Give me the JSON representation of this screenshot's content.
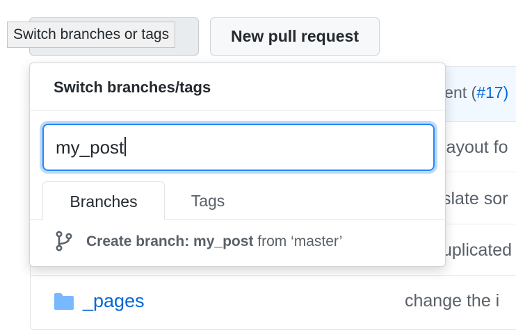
{
  "tooltip": "Switch branches or tags",
  "new_pr_label": "New pull request",
  "background": {
    "commit_message_fragment": "ment (",
    "commit_link": "#17",
    "commit_close": ")",
    "row_fragments": [
      "layout fo",
      "slate sor",
      "uplicated"
    ],
    "folder_name": "_pages",
    "folder_commit": "change the i"
  },
  "dropdown": {
    "title": "Switch branches/tags",
    "filter_value": "my_post",
    "tabs": [
      "Branches",
      "Tags"
    ],
    "create_prefix": "Create branch: ",
    "create_branch_name": "my_post",
    "create_suffix": " from ‘master’"
  },
  "icons": {
    "folder": "folder-icon",
    "branch": "git-branch-icon"
  },
  "colors": {
    "link": "#0366d6",
    "focus": "#2188ff",
    "folder": "#79b8ff"
  }
}
